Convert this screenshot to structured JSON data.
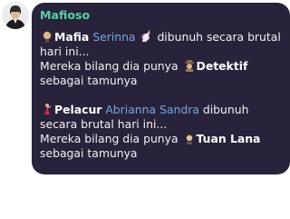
{
  "message": {
    "sender": "Mafioso",
    "block1": {
      "killer_role": "Mafia",
      "victim": "Serinna",
      "action": "dibunuh secara brutal hari ini...",
      "line2_prefix": "Mereka bilang dia punya",
      "role": "Detektif",
      "line2_suffix": "sebagai tamunya"
    },
    "block2": {
      "killer_role": "Pelacur",
      "victim": "Abrianna Sandra",
      "action": "dibunuh secara brutal hari ini...",
      "line2_prefix": "Mereka bilang dia punya",
      "role": "Tuan Lana",
      "line2_suffix": "sebagai tamunya"
    }
  },
  "icons": {
    "avatar": "mafioso-avatar",
    "mafia": "mafia-icon",
    "victim1": "unicorn-icon",
    "detective": "detective-icon",
    "harlot": "dancer-icon",
    "host": "host-icon"
  },
  "colors": {
    "bubble": "#28223a",
    "sender": "#58d1a1",
    "player_name": "#74a9e2",
    "text": "#f2f2f2"
  }
}
